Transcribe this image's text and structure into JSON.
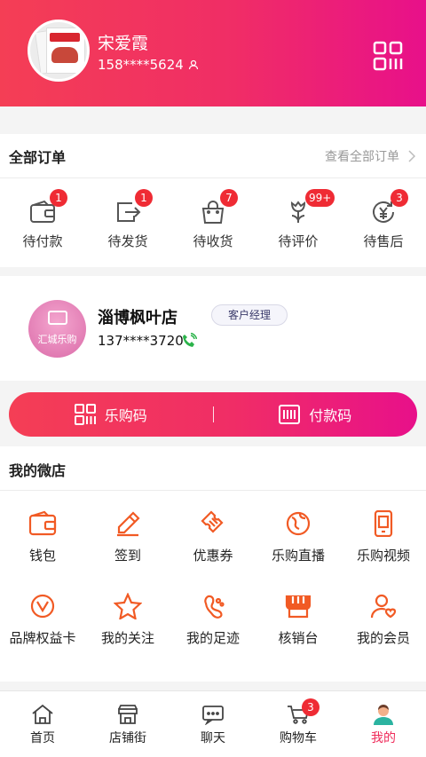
{
  "user": {
    "name": "宋爱霞",
    "phone": "158****5624"
  },
  "orders": {
    "title": "全部订单",
    "view_all": "查看全部订单",
    "items": [
      {
        "label": "待付款",
        "icon": "wallet-icon",
        "badge": "1"
      },
      {
        "label": "待发货",
        "icon": "ship-icon",
        "badge": "1"
      },
      {
        "label": "待收货",
        "icon": "bag-icon",
        "badge": "7"
      },
      {
        "label": "待评价",
        "icon": "review-icon",
        "badge": "99+"
      },
      {
        "label": "待售后",
        "icon": "after-sale-icon",
        "badge": "3"
      }
    ]
  },
  "store": {
    "name": "淄博枫叶店",
    "tag": "客户经理",
    "phone": "137****3720",
    "logo_text": "汇城乐购"
  },
  "codes": {
    "shop_code": "乐购码",
    "pay_code": "付款码"
  },
  "shop": {
    "title": "我的微店",
    "items": [
      {
        "label": "钱包",
        "icon": "wallet-icon"
      },
      {
        "label": "签到",
        "icon": "pencil-icon"
      },
      {
        "label": "优惠券",
        "icon": "coupon-icon"
      },
      {
        "label": "乐购直播",
        "icon": "live-icon"
      },
      {
        "label": "乐购视频",
        "icon": "video-icon"
      },
      {
        "label": "品牌权益卡",
        "icon": "card-icon"
      },
      {
        "label": "我的关注",
        "icon": "star-icon"
      },
      {
        "label": "我的足迹",
        "icon": "footprint-icon"
      },
      {
        "label": "核销台",
        "icon": "counter-icon"
      },
      {
        "label": "我的会员",
        "icon": "member-icon"
      }
    ]
  },
  "tabbar": {
    "items": [
      {
        "label": "首页",
        "icon": "home-icon"
      },
      {
        "label": "店铺街",
        "icon": "store-icon"
      },
      {
        "label": "聊天",
        "icon": "chat-icon"
      },
      {
        "label": "购物车",
        "icon": "cart-icon",
        "badge": "3"
      },
      {
        "label": "我的",
        "icon": "profile-icon",
        "active": true
      }
    ]
  },
  "colors": {
    "accent": "#ef2b5a",
    "icon_orange": "#f15a24",
    "badge": "#ef2b34"
  }
}
